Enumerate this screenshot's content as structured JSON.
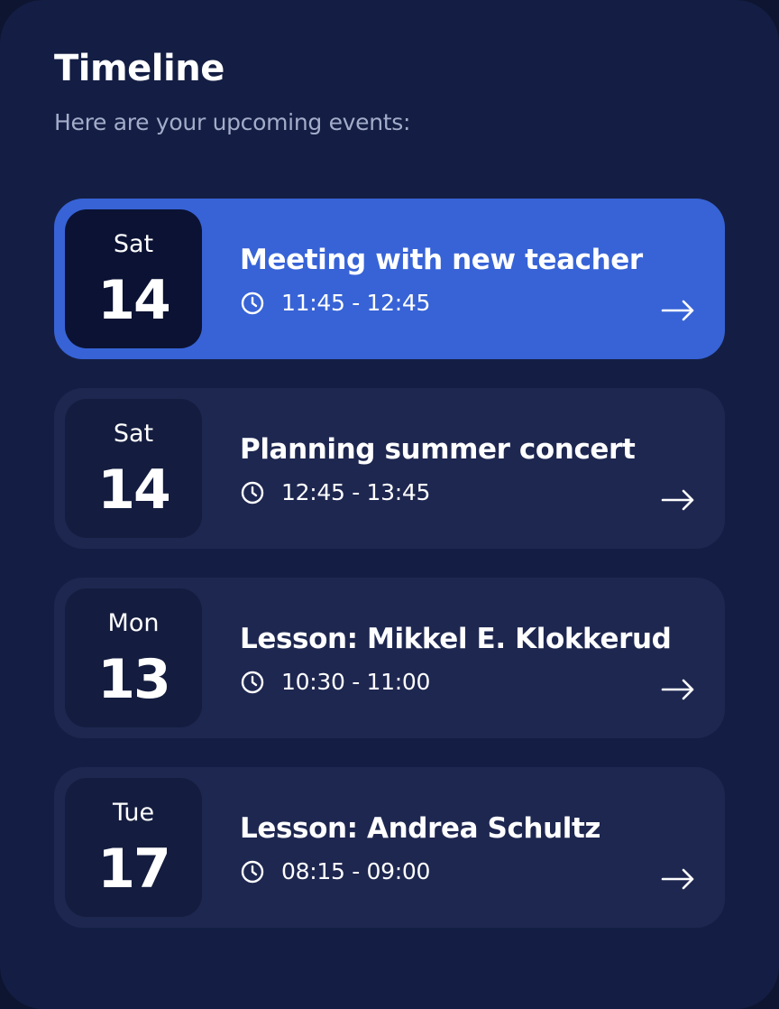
{
  "header": {
    "title": "Timeline",
    "subtitle": "Here are your upcoming events:"
  },
  "events": [
    {
      "day_name": "Sat",
      "day_num": "14",
      "title": "Meeting with new teacher",
      "time": "11:45 - 12:45",
      "active": true
    },
    {
      "day_name": "Sat",
      "day_num": "14",
      "title": "Planning summer concert",
      "time": "12:45 - 13:45",
      "active": false
    },
    {
      "day_name": "Mon",
      "day_num": "13",
      "title": "Lesson: Mikkel E. Klokkerud",
      "time": "10:30 - 11:00",
      "active": false
    },
    {
      "day_name": "Tue",
      "day_num": "17",
      "title": "Lesson: Andrea Schultz",
      "time": "08:15 - 09:00",
      "active": false
    }
  ],
  "icons": {
    "time": "clock-icon",
    "open": "arrow-right-icon"
  },
  "colors": {
    "background": "#141e44",
    "active_card": "#3763d6",
    "card": "#1e2750",
    "date_box": "#141d3f",
    "active_date_box": "#0b1233",
    "subtitle_text": "#a3acc9"
  }
}
